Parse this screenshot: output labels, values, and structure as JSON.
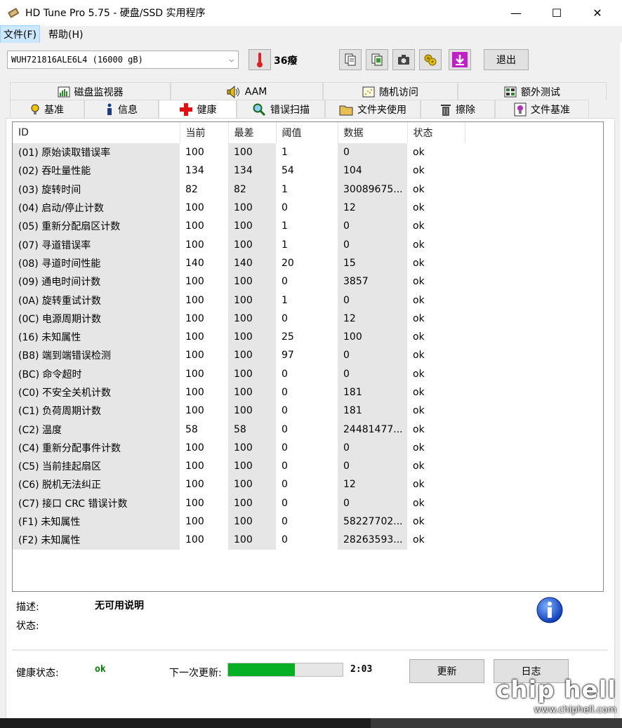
{
  "window": {
    "title": "HD Tune Pro 5.75 - 硬盘/SSD 实用程序",
    "minimize_glyph": "—",
    "maximize_glyph": "☐",
    "close_glyph": "✕"
  },
  "menu": {
    "file": "文件(F)",
    "help": "帮助(H)"
  },
  "toolbar": {
    "drive": "WUH721816ALE6L4 (16000 gB)",
    "temperature": "36癈",
    "exit_label": "退出",
    "icons": [
      "thermometer-icon",
      "copy-text-icon",
      "copy-screenshot-icon",
      "camera-icon",
      "options-icon",
      "save-down-icon"
    ]
  },
  "tabs_top": [
    {
      "label": "磁盘监视器",
      "icon": "bar-chart-icon"
    },
    {
      "label": "AAM",
      "icon": "speaker-icon"
    },
    {
      "label": "随机访问",
      "icon": "scatter-icon"
    },
    {
      "label": "额外测试",
      "icon": "grid-icon"
    }
  ],
  "tabs_bottom": [
    {
      "label": "基准",
      "icon": "bulb-icon"
    },
    {
      "label": "信息",
      "icon": "info-i-icon"
    },
    {
      "label": "健康",
      "icon": "red-cross-icon"
    },
    {
      "label": "错误扫描",
      "icon": "magnifier-icon"
    },
    {
      "label": "文件夹使用",
      "icon": "folder-icon"
    },
    {
      "label": "擦除",
      "icon": "trash-icon"
    },
    {
      "label": "文件基准",
      "icon": "file-bulb-icon"
    }
  ],
  "table": {
    "columns": [
      "ID",
      "当前",
      "最差",
      "阈值",
      "数据",
      "状态"
    ],
    "rows": [
      [
        "(01) 原始读取错误率",
        "100",
        "100",
        "1",
        "0",
        "ok"
      ],
      [
        "(02) 吞吐量性能",
        "134",
        "134",
        "54",
        "104",
        "ok"
      ],
      [
        "(03) 旋转时间",
        "82",
        "82",
        "1",
        "30089675...",
        "ok"
      ],
      [
        "(04) 启动/停止计数",
        "100",
        "100",
        "0",
        "12",
        "ok"
      ],
      [
        "(05) 重新分配扇区计数",
        "100",
        "100",
        "1",
        "0",
        "ok"
      ],
      [
        "(07) 寻道错误率",
        "100",
        "100",
        "1",
        "0",
        "ok"
      ],
      [
        "(08) 寻道时间性能",
        "140",
        "140",
        "20",
        "15",
        "ok"
      ],
      [
        "(09) 通电时间计数",
        "100",
        "100",
        "0",
        "3857",
        "ok"
      ],
      [
        "(0A) 旋转重试计数",
        "100",
        "100",
        "1",
        "0",
        "ok"
      ],
      [
        "(0C) 电源周期计数",
        "100",
        "100",
        "0",
        "12",
        "ok"
      ],
      [
        "(16) 未知属性",
        "100",
        "100",
        "25",
        "100",
        "ok"
      ],
      [
        "(B8) 端到端错误检测",
        "100",
        "100",
        "97",
        "0",
        "ok"
      ],
      [
        "(BC) 命令超时",
        "100",
        "100",
        "0",
        "0",
        "ok"
      ],
      [
        "(C0) 不安全关机计数",
        "100",
        "100",
        "0",
        "181",
        "ok"
      ],
      [
        "(C1) 负荷周期计数",
        "100",
        "100",
        "0",
        "181",
        "ok"
      ],
      [
        "(C2) 温度",
        "58",
        "58",
        "0",
        "24481477...",
        "ok"
      ],
      [
        "(C4) 重新分配事件计数",
        "100",
        "100",
        "0",
        "0",
        "ok"
      ],
      [
        "(C5) 当前挂起扇区",
        "100",
        "100",
        "0",
        "0",
        "ok"
      ],
      [
        "(C6) 脱机无法纠正",
        "100",
        "100",
        "0",
        "12",
        "ok"
      ],
      [
        "(C7) 接口 CRC 错误计数",
        "100",
        "100",
        "0",
        "0",
        "ok"
      ],
      [
        "(F1) 未知属性",
        "100",
        "100",
        "0",
        "58227702...",
        "ok"
      ],
      [
        "(F2) 未知属性",
        "100",
        "100",
        "0",
        "28263593...",
        "ok"
      ]
    ]
  },
  "details": {
    "description_label": "描述:",
    "description_value": "无可用说明",
    "status_label": "状态:"
  },
  "health": {
    "label": "健康状态:",
    "value": "ok",
    "value_color": "#008000",
    "next_update_label": "下一次更新:",
    "progress_fraction": 0.58,
    "progress_color": "#06b025",
    "countdown": "2:03",
    "refresh_label": "更新",
    "log_label": "日志"
  },
  "watermark": {
    "brand": "chip hell",
    "site": "www.chiphell.com"
  }
}
